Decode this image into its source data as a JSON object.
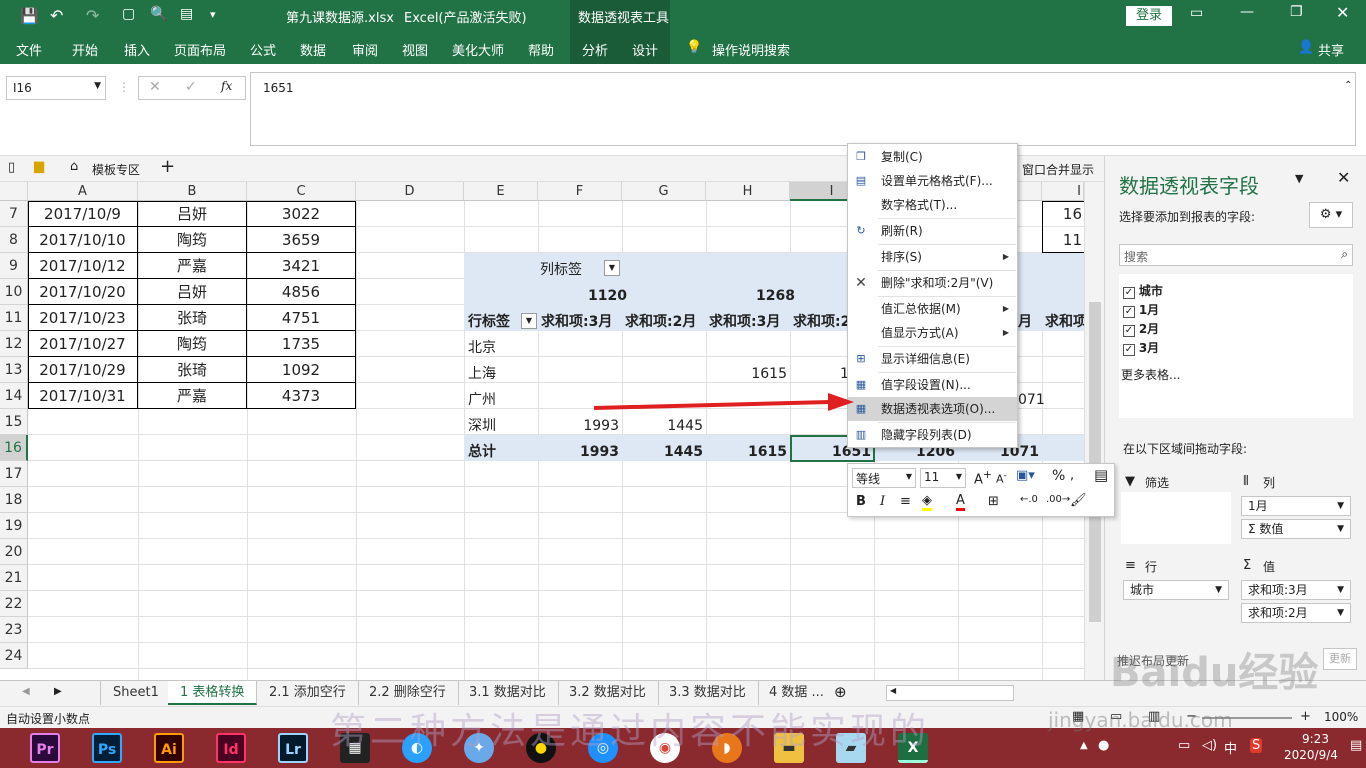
{
  "window": {
    "filename": "第九课数据源.xlsx",
    "app_title": "Excel(产品激活失败)",
    "context_group": "数据透视表工具",
    "login_label": "登录"
  },
  "ribbon": {
    "tabs": [
      "文件",
      "开始",
      "插入",
      "页面布局",
      "公式",
      "数据",
      "审阅",
      "视图",
      "美化大师",
      "帮助",
      "分析",
      "设计"
    ],
    "tell_me": "操作说明搜索",
    "share": "共享"
  },
  "formula_bar": {
    "name_box": "I16",
    "fx": "fx",
    "value": "1651"
  },
  "quick_bar": {
    "template_label": "模板专区",
    "merge_window": "窗口合并显示"
  },
  "columns": [
    "A",
    "B",
    "C",
    "D",
    "E",
    "F",
    "G",
    "H",
    "I",
    "",
    "",
    "I"
  ],
  "rows": [
    "7",
    "8",
    "9",
    "10",
    "11",
    "12",
    "13",
    "14",
    "15",
    "16",
    "17",
    "18",
    "19",
    "20",
    "21",
    "22",
    "23",
    "24"
  ],
  "table": [
    [
      "2017/10/9",
      "吕妍",
      "3022"
    ],
    [
      "2017/10/10",
      "陶筠",
      "3659"
    ],
    [
      "2017/10/12",
      "严嘉",
      "3421"
    ],
    [
      "2017/10/20",
      "吕妍",
      "4856"
    ],
    [
      "2017/10/23",
      "张琦",
      "4751"
    ],
    [
      "2017/10/27",
      "陶筠",
      "1735"
    ],
    [
      "2017/10/29",
      "张琦",
      "1092"
    ],
    [
      "2017/10/31",
      "严嘉",
      "4373"
    ]
  ],
  "right_partial": [
    "16",
    "11"
  ],
  "pivot": {
    "col_label": "列标签",
    "row_label": "行标签",
    "col_groups": [
      "1120",
      "1268"
    ],
    "headers": [
      "求和项:3月",
      "求和项:2月",
      "求和项:3月",
      "求和项:2",
      "月",
      "求和项"
    ],
    "rows": [
      {
        "name": "北京",
        "vals": [
          "",
          "",
          "",
          ""
        ]
      },
      {
        "name": "上海",
        "vals": [
          "",
          "",
          "1615",
          "1"
        ]
      },
      {
        "name": "广州",
        "vals": [
          "",
          "",
          "",
          "",
          "071"
        ]
      },
      {
        "name": "深圳",
        "vals": [
          "1993",
          "1445",
          "",
          ""
        ]
      }
    ],
    "total": {
      "name": "总计",
      "vals": [
        "1993",
        "1445",
        "1615",
        "1651",
        "1206",
        "1071"
      ]
    }
  },
  "context_menu": [
    {
      "label": "复制(C)",
      "icon": "copy-icon"
    },
    {
      "label": "设置单元格格式(F)...",
      "icon": "format-cells-icon"
    },
    {
      "label": "数字格式(T)...",
      "icon": ""
    },
    {
      "label": "刷新(R)",
      "icon": "refresh-icon"
    },
    {
      "label": "排序(S)",
      "icon": "",
      "sub": true
    },
    {
      "label": "删除\"求和项:2月\"(V)",
      "icon": "delete-icon"
    },
    {
      "label": "值汇总依据(M)",
      "icon": "",
      "sub": true
    },
    {
      "label": "值显示方式(A)",
      "icon": "",
      "sub": true
    },
    {
      "label": "显示详细信息(E)",
      "icon": "details-icon"
    },
    {
      "label": "值字段设置(N)...",
      "icon": "field-settings-icon"
    },
    {
      "label": "数据透视表选项(O)...",
      "icon": "pivot-options-icon",
      "highlighted": true
    },
    {
      "label": "隐藏字段列表(D)",
      "icon": "field-list-icon"
    }
  ],
  "mini_toolbar": {
    "font": "等线",
    "size": "11",
    "percent": "%"
  },
  "field_pane": {
    "title": "数据透视表字段",
    "subtitle": "选择要添加到报表的字段:",
    "search_placeholder": "搜索",
    "fields": [
      "城市",
      "1月",
      "2月",
      "3月"
    ],
    "more_tables": "更多表格...",
    "drag_hint": "在以下区域间拖动字段:",
    "filter_label": "筛选",
    "columns_label": "列",
    "rows_label": "行",
    "values_label": "值",
    "columns_items": [
      "1月",
      "Σ 数值"
    ],
    "rows_items": [
      "城市"
    ],
    "values_items": [
      "求和项:3月",
      "求和项:2月"
    ],
    "defer_label": "推迟布局更新",
    "update_button": "更新"
  },
  "sheet_tabs": [
    "Sheet1",
    "1 表格转换",
    "2.1 添加空行",
    "2.2 删除空行",
    "3.1 数据对比",
    "3.2 数据对比",
    "3.3 数据对比",
    "4 数据 ..."
  ],
  "status": {
    "left": "自动设置小数点",
    "zoom": "100%"
  },
  "taskbar": {
    "apps": [
      "Pr",
      "Ps",
      "Ai",
      "Id",
      "Lr"
    ],
    "time": "9:23",
    "date": "2020/9/4",
    "ime": "中"
  },
  "overlay_text": {
    "watermark": "Baidu经验",
    "url": "jingyan.baidu.com",
    "subtitle": "第二种方法是通过内容不能实现的"
  },
  "colors": {
    "excel_green": "#217346",
    "selection": "#217346",
    "pivot_fill": "#dde8f4",
    "arrow": "#e02020",
    "taskbar": "#8b2a2e"
  }
}
